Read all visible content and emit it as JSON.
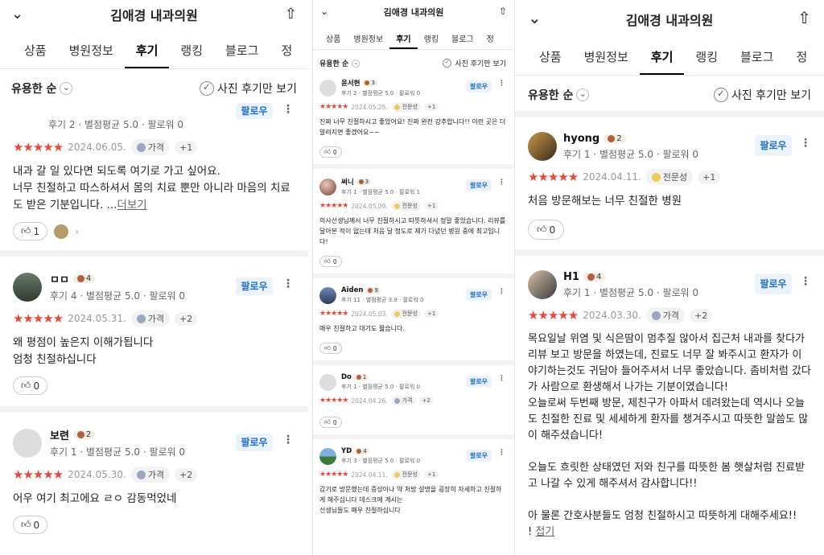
{
  "title": "김애경 내과의원",
  "tabs": [
    "상품",
    "병원정보",
    "후기",
    "랭킹",
    "블로그",
    "정"
  ],
  "sort": "유용한 순",
  "photo_only": "사진 후기만 보기",
  "follow": "팔로우",
  "more_link": "더보기",
  "fold_link": "접기",
  "tag_expertise": "전문성",
  "tag_price": "가격",
  "panel1": {
    "partial_meta": "후기 2 · 별점평균 5.0 · 팔로워 0",
    "partial_date": "2024.06.05.",
    "partial_plus": "+1",
    "partial_text": "내과 갈 일 있다면 되도록 여기로 가고 싶어요.\n너무 친절하고 따스하셔서 몸의 치료 뿐만 아니라 마음의 치료도 받은 기분입니다. ...",
    "partial_likes": "1",
    "r1_name": "ㅁㅁ",
    "r1_badge": "4",
    "r1_meta": "후기 4 · 별점평균 5.0 · 팔로워 0",
    "r1_date": "2024.05.31.",
    "r1_plus": "+2",
    "r1_text": "왜 평점이 높은지 이해가됩니다\n엄청 친절하십니다",
    "r1_likes": "0",
    "r2_name": "보련",
    "r2_badge": "2",
    "r2_meta": "후기 1 · 별점평균 5.0 · 팔로워 0",
    "r2_date": "2024.05.30.",
    "r2_plus": "+2",
    "r2_text": "어우 여기 최고에요 ㄹㅇ 감동먹었네",
    "r2_likes": "0"
  },
  "panel2": {
    "a_name": "윤서현",
    "a_badge": "3",
    "a_meta": "후기 2 · 별점평균 5.0 · 팔로워 0",
    "a_date": "2024.05.25.",
    "a_plus": "+1",
    "a_text": "진짜 너무 친절하시고 좋았어요! 진짜 완전 강추합니다!! 이런 곳은 더 알려지면 좋겠어요~~",
    "a_likes": "0",
    "b_name": "써니",
    "b_badge": "3",
    "b_meta": "후기 1 · 별점평균 5.0 · 팔로워 1",
    "b_date": "2024.05.09.",
    "b_plus": "+1",
    "b_text": "의사선생님께서 너무 친절하시고 따뜻하셔서 정말 좋았습니다. 리뷰를 달아본 적이 없는데 처음 달 정도로 제가 다녔던 병원 중에 최고입니다!",
    "b_likes": "0",
    "c_name": "Aiden",
    "c_badge": "9",
    "c_meta": "후기 11 · 별점평균 3.9 · 팔로워 0",
    "c_date": "2024.05.03.",
    "c_plus": "+1",
    "c_text": "매우 친절하고 대기도 짧습니다.",
    "c_likes": "0",
    "d_name": "Do",
    "d_badge": "1",
    "d_meta": "후기 1 · 별점평균 5.0 · 팔로워 0",
    "d_date": "2024.04.26.",
    "d_plus": "+2",
    "d_text": "",
    "d_likes": "0",
    "e_name": "YD",
    "e_badge": "4",
    "e_meta": "후기 3 · 별점평균 5.0 · 팔로워 0",
    "e_date": "2024.04.11.",
    "e_plus": "+1",
    "e_text": "감기로 방문했는데 증상이나 약 처방 설명을 굉장히 자세하고 친절하게 해주십니다 데스크에 계시는\n선생님들도 매우 친절하십니다"
  },
  "panel3": {
    "a_name": "hyong",
    "a_badge": "2",
    "a_meta": "후기 1 · 별점평균 5.0 · 팔로워 0",
    "a_date": "2024.04.11.",
    "a_plus": "+1",
    "a_text": "처음 방문해보는 너무 친절한 병원",
    "a_likes": "0",
    "b_name": "H1",
    "b_badge": "4",
    "b_meta": "후기 1 · 별점평균 5.0 · 팔로워 0",
    "b_date": "2024.03.30.",
    "b_plus": "+2",
    "b_text": "목요일날 위염 및 식은땀이 멈추질 않아서 집근처 내과를 찾다가 리뷰 보고 방문을 하였는데, 진료도 너무 잘 봐주시고 환자가 이야기하는것도 귀담아 들어주셔서 너무 좋았습니다. 좀비처럼 갔다가 사람으로 환생해서 나가는 기분이였습니다!\n오늘로써 두번째 방문, 제친구가 아파서 데려왔는데 역시나 오늘도 친절한 진료 및 세세하게 환자를 챙겨주시고 따뜻한 말씀도 많이 해주셨습니다!\n\n오늘도 흐릿한 상태였던 저와 친구를 따뜻한 봄 햇살처럼 진료받고 나갈 수 있게 해주셔서 감사합니다!!\n\n아 물론 간호사분들도 엄청 친절하시고 따뜻하게 대해주세요!!\n!"
  }
}
